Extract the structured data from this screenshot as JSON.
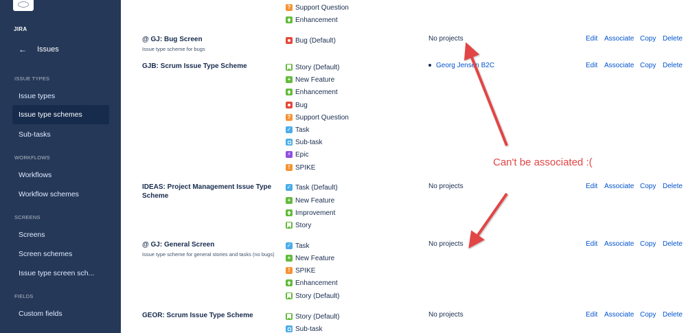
{
  "sidebar": {
    "app_label": "JIRA",
    "back": {
      "icon": "arrow-left-icon",
      "label": "Issues"
    },
    "sections": [
      {
        "title": "ISSUE TYPES",
        "items": [
          "Issue types",
          "Issue type schemes",
          "Sub-tasks"
        ]
      },
      {
        "title": "WORKFLOWS",
        "items": [
          "Workflows",
          "Workflow schemes"
        ]
      },
      {
        "title": "SCREENS",
        "items": [
          "Screens",
          "Screen schemes",
          "Issue type screen sch..."
        ]
      },
      {
        "title": "FIELDS",
        "items": [
          "Custom fields"
        ]
      }
    ],
    "active_item": "Issue type schemes"
  },
  "schemes": [
    {
      "name": "",
      "description": "",
      "issue_types": [
        {
          "icon": "question-icon",
          "label": "Support Question"
        },
        {
          "icon": "improvement-icon",
          "label": "Enhancement"
        }
      ]
    },
    {
      "name": "@ GJ: Bug Screen",
      "description": "Issue type scheme for bugs",
      "issue_types": [
        {
          "icon": "bug-icon",
          "label": "Bug (Default)"
        }
      ],
      "projects": "No projects"
    },
    {
      "name": "GJB: Scrum Issue Type Scheme",
      "description": "",
      "issue_types": [
        {
          "icon": "story-icon",
          "label": "Story (Default)"
        },
        {
          "icon": "new-feature-icon",
          "label": "New Feature"
        },
        {
          "icon": "improvement-icon",
          "label": "Enhancement"
        },
        {
          "icon": "bug-icon",
          "label": "Bug"
        },
        {
          "icon": "question-icon",
          "label": "Support Question"
        },
        {
          "icon": "task-icon",
          "label": "Task"
        },
        {
          "icon": "subtask-icon",
          "label": "Sub-task"
        },
        {
          "icon": "epic-icon",
          "label": "Epic"
        },
        {
          "icon": "spike-icon",
          "label": "SPIKE"
        }
      ],
      "project_link": "Georg Jensen B2C"
    },
    {
      "name": "IDEAS: Project Management Issue Type Scheme",
      "description": "",
      "issue_types": [
        {
          "icon": "task-icon",
          "label": "Task (Default)"
        },
        {
          "icon": "new-feature-icon",
          "label": "New Feature"
        },
        {
          "icon": "improvement-icon",
          "label": "Improvement"
        },
        {
          "icon": "story-icon",
          "label": "Story"
        }
      ],
      "projects": "No projects"
    },
    {
      "name": "@ GJ: General Screen",
      "description": "Issue type scheme for general stories and tasks (no bugs)",
      "issue_types": [
        {
          "icon": "task-icon",
          "label": "Task"
        },
        {
          "icon": "new-feature-icon",
          "label": "New Feature"
        },
        {
          "icon": "spike-icon",
          "label": "SPIKE"
        },
        {
          "icon": "improvement-icon",
          "label": "Enhancement"
        },
        {
          "icon": "story-icon",
          "label": "Story (Default)"
        }
      ],
      "projects": "No projects"
    },
    {
      "name": "GEOR: Scrum Issue Type Scheme",
      "description": "",
      "issue_types": [
        {
          "icon": "story-icon",
          "label": "Story (Default)"
        },
        {
          "icon": "subtask-icon",
          "label": "Sub-task"
        }
      ],
      "projects": "No projects"
    }
  ],
  "operations": {
    "edit": "Edit",
    "associate": "Associate",
    "copy": "Copy",
    "delete": "Delete"
  },
  "annotation": {
    "text": "Can't be associated :(",
    "color": "#e24444"
  },
  "colors": {
    "sidebar_bg": "#253858",
    "active_bg": "#172b4d",
    "link": "#0052cc"
  }
}
